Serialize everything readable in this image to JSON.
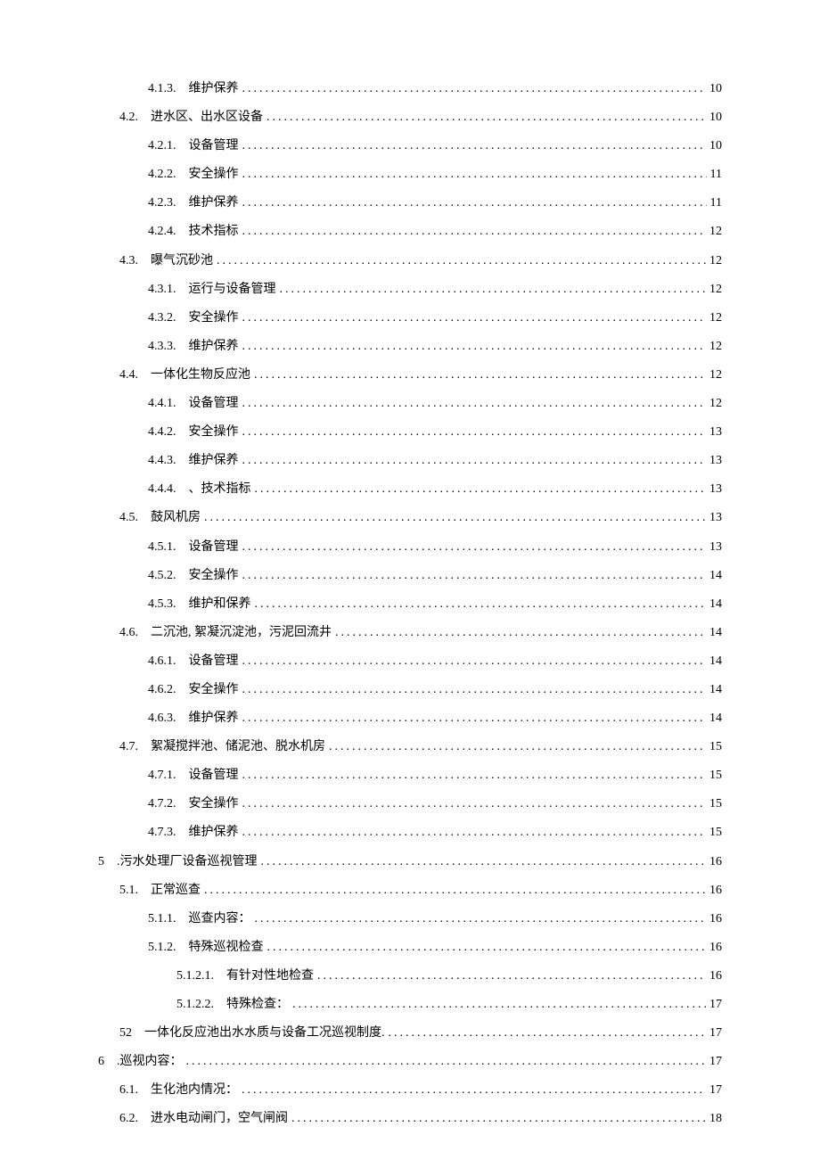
{
  "toc": [
    {
      "indent": 3,
      "num": "4.1.3.",
      "title": "维护保养",
      "page": "10"
    },
    {
      "indent": 2,
      "num": "4.2.",
      "title": "进水区、出水区设备",
      "page": "10"
    },
    {
      "indent": 3,
      "num": "4.2.1.",
      "title": "设备管理",
      "page": "10"
    },
    {
      "indent": 3,
      "num": "4.2.2.",
      "title": "安全操作",
      "page": "11"
    },
    {
      "indent": 3,
      "num": "4.2.3.",
      "title": "维护保养",
      "page": "11"
    },
    {
      "indent": 3,
      "num": "4.2.4.",
      "title": "技术指标",
      "page": "12"
    },
    {
      "indent": 2,
      "num": "4.3.",
      "title": "曝气沉砂池",
      "page": "12"
    },
    {
      "indent": 3,
      "num": "4.3.1.",
      "title": "运行与设备管理",
      "page": "12"
    },
    {
      "indent": 3,
      "num": "4.3.2.",
      "title": "安全操作",
      "page": "12"
    },
    {
      "indent": 3,
      "num": "4.3.3.",
      "title": "维护保养",
      "page": "12"
    },
    {
      "indent": 2,
      "num": "4.4.",
      "title": "一体化生物反应池",
      "page": "12"
    },
    {
      "indent": 3,
      "num": "4.4.1.",
      "title": "设备管理",
      "page": "12"
    },
    {
      "indent": 3,
      "num": "4.4.2.",
      "title": "安全操作",
      "page": "13"
    },
    {
      "indent": 3,
      "num": "4.4.3.",
      "title": "维护保养",
      "page": "13"
    },
    {
      "indent": 3,
      "num": "4.4.4.",
      "title": "、技术指标",
      "page": "13"
    },
    {
      "indent": 2,
      "num": "4.5.",
      "title": "鼓风机房",
      "page": "13"
    },
    {
      "indent": 3,
      "num": "4.5.1.",
      "title": "设备管理",
      "page": "13"
    },
    {
      "indent": 3,
      "num": "4.5.2.",
      "title": "安全操作",
      "page": "14"
    },
    {
      "indent": 3,
      "num": "4.5.3.",
      "title": "维护和保养",
      "page": "14"
    },
    {
      "indent": 2,
      "num": "4.6.",
      "title": "二沉池, 絮凝沉淀池，污泥回流井",
      "page": "14"
    },
    {
      "indent": 3,
      "num": "4.6.1.",
      "title": "设备管理",
      "page": "14"
    },
    {
      "indent": 3,
      "num": "4.6.2.",
      "title": "安全操作",
      "page": "14"
    },
    {
      "indent": 3,
      "num": "4.6.3.",
      "title": "维护保养",
      "page": "14"
    },
    {
      "indent": 2,
      "num": "4.7.",
      "title": "絮凝搅拌池、储泥池、脱水机房",
      "page": "15"
    },
    {
      "indent": 3,
      "num": "4.7.1.",
      "title": "设备管理",
      "page": "15"
    },
    {
      "indent": 3,
      "num": "4.7.2.",
      "title": "安全操作",
      "page": "15"
    },
    {
      "indent": 3,
      "num": "4.7.3.",
      "title": "维护保养",
      "page": "15"
    },
    {
      "indent": 1,
      "num": "5",
      "title": ".污水处理厂设备巡视管理",
      "page": "16"
    },
    {
      "indent": 2,
      "num": "5.1.",
      "title": "正常巡查",
      "page": "16"
    },
    {
      "indent": 3,
      "num": "5.1.1.",
      "title": "巡查内容：",
      "page": "16"
    },
    {
      "indent": 3,
      "num": "5.1.2.",
      "title": "特殊巡视检查",
      "page": "16"
    },
    {
      "indent": 4,
      "num": "5.1.2.1.",
      "title": "有针对性地检查",
      "page": "16"
    },
    {
      "indent": 4,
      "num": "5.1.2.2.",
      "title": "特殊检查：",
      "page": "17"
    },
    {
      "indent": 2,
      "num": "52",
      "title": "一体化反应池出水水质与设备工况巡视制度.",
      "page": "17"
    },
    {
      "indent": 1,
      "num": "6",
      "title": ".巡视内容：",
      "page": "17"
    },
    {
      "indent": 2,
      "num": "6.1.",
      "title": "生化池内情况：",
      "page": "17"
    },
    {
      "indent": 2,
      "num": "6.2.",
      "title": "进水电动闸门，空气闸阀",
      "page": "18"
    }
  ]
}
